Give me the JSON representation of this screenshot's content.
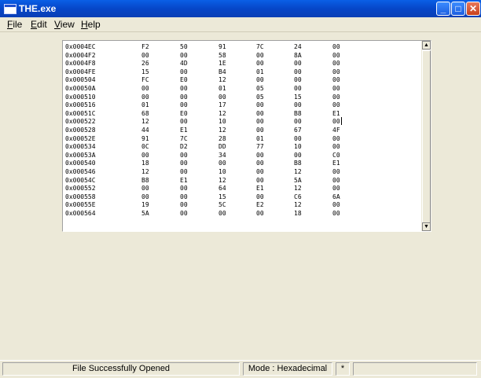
{
  "window": {
    "title": "THE.exe",
    "minimize_glyph": "_",
    "maximize_glyph": "□",
    "close_glyph": "✕"
  },
  "menu": {
    "items": [
      {
        "label_u": "F",
        "label_rest": "ile"
      },
      {
        "label_u": "E",
        "label_rest": "dit"
      },
      {
        "label_u": "V",
        "label_rest": "iew"
      },
      {
        "label_u": "H",
        "label_rest": "elp"
      }
    ]
  },
  "hex_rows": [
    [
      "0x0004EC",
      "F2",
      "50",
      "91",
      "7C",
      "24",
      "00"
    ],
    [
      "0x0004F2",
      "00",
      "00",
      "58",
      "00",
      "8A",
      "00"
    ],
    [
      "0x0004F8",
      "26",
      "4D",
      "1E",
      "00",
      "00",
      "00"
    ],
    [
      "0x0004FE",
      "15",
      "00",
      "B4",
      "01",
      "00",
      "00"
    ],
    [
      "0x000504",
      "FC",
      "E0",
      "12",
      "00",
      "00",
      "00"
    ],
    [
      "0x00050A",
      "00",
      "00",
      "01",
      "05",
      "00",
      "00"
    ],
    [
      "0x000510",
      "00",
      "00",
      "00",
      "05",
      "15",
      "00"
    ],
    [
      "0x000516",
      "01",
      "00",
      "17",
      "00",
      "00",
      "00"
    ],
    [
      "0x00051C",
      "68",
      "E0",
      "12",
      "00",
      "B8",
      "E1"
    ],
    [
      "0x000522",
      "12",
      "00",
      "10",
      "00",
      "00",
      "00"
    ],
    [
      "0x000528",
      "44",
      "E1",
      "12",
      "00",
      "67",
      "4F"
    ],
    [
      "0x00052E",
      "91",
      "7C",
      "28",
      "01",
      "00",
      "00"
    ],
    [
      "0x000534",
      "0C",
      "D2",
      "DD",
      "77",
      "10",
      "00"
    ],
    [
      "0x00053A",
      "00",
      "00",
      "34",
      "00",
      "00",
      "C0"
    ],
    [
      "0x000540",
      "18",
      "00",
      "00",
      "00",
      "B8",
      "E1"
    ],
    [
      "0x000546",
      "12",
      "00",
      "10",
      "00",
      "12",
      "00"
    ],
    [
      "0x00054C",
      "B8",
      "E1",
      "12",
      "00",
      "5A",
      "00"
    ],
    [
      "0x000552",
      "00",
      "00",
      "64",
      "E1",
      "12",
      "00"
    ],
    [
      "0x000558",
      "00",
      "00",
      "15",
      "00",
      "C6",
      "6A"
    ],
    [
      "0x00055E",
      "19",
      "00",
      "5C",
      "E2",
      "12",
      "00"
    ],
    [
      "0x000564",
      "5A",
      "00",
      "00",
      "00",
      "18",
      "00"
    ]
  ],
  "scroll": {
    "up_glyph": "▲",
    "down_glyph": "▼"
  },
  "status": {
    "message": "File Successfully Opened",
    "mode": "Mode : Hexadecimal",
    "modified": "*",
    "extra": ""
  }
}
